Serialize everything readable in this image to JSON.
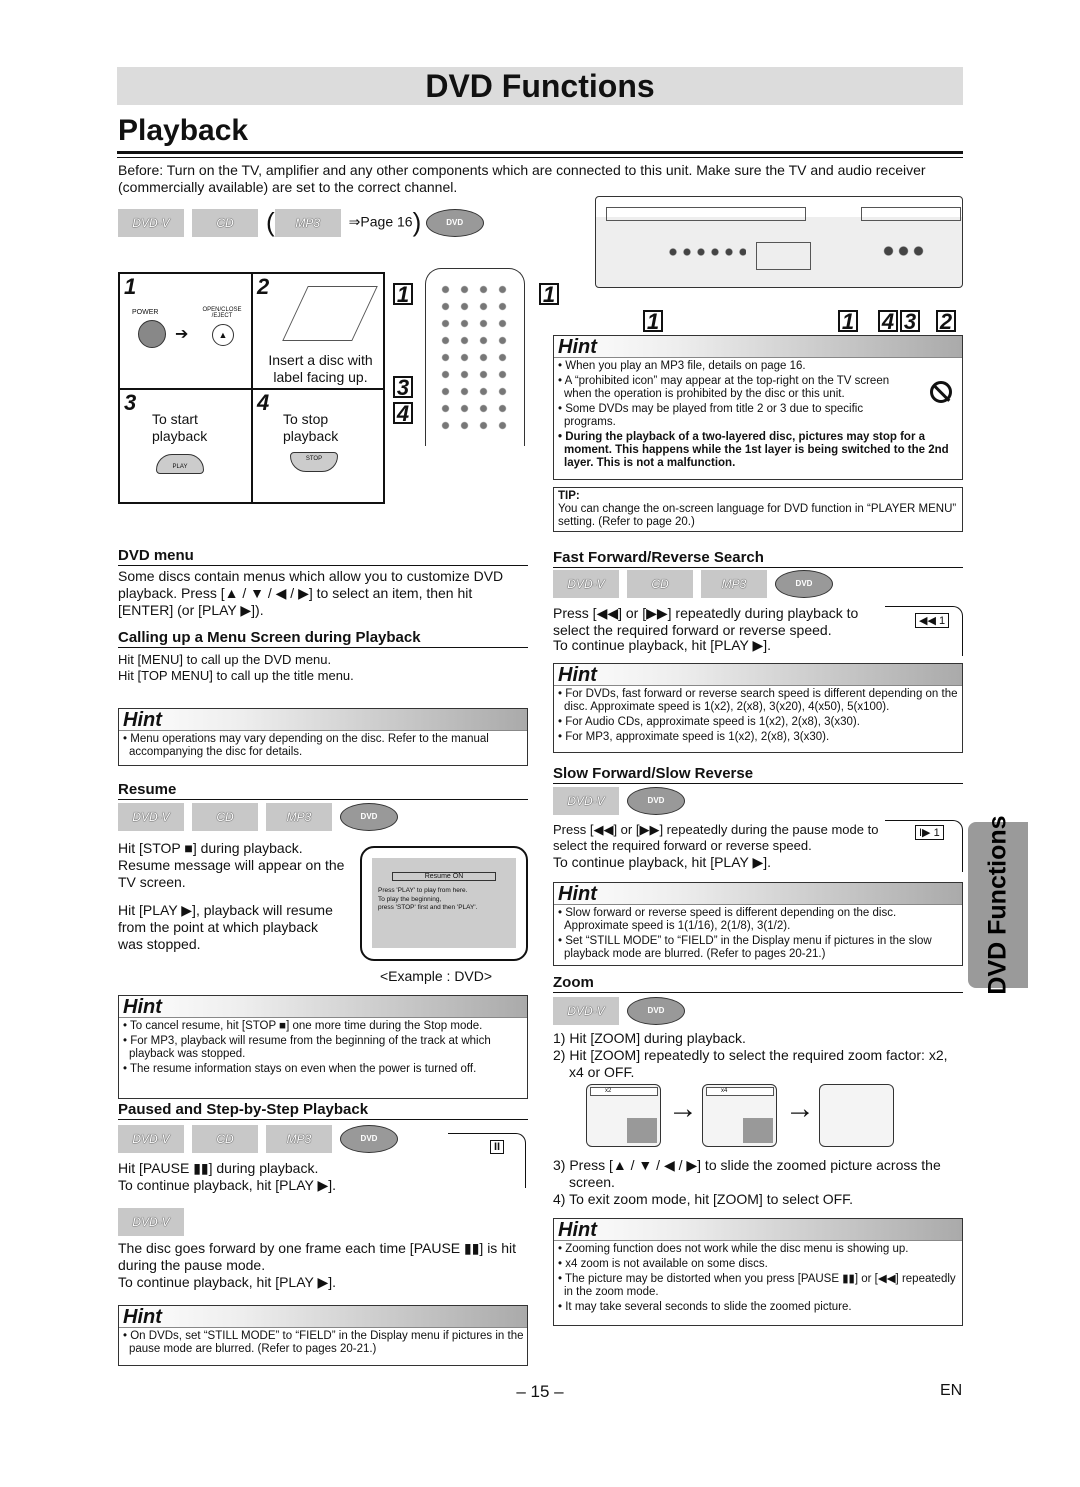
{
  "header": {
    "section": "DVD Functions",
    "title": "Playback"
  },
  "intro": "Before: Turn on the TV, amplifier and any other components which are connected to this unit. Make sure the TV and audio receiver (commercially available) are set to the correct channel.",
  "discs": {
    "dvdv": "DVD-V",
    "cd": "CD",
    "mp3": "MP3",
    "page_ref": "⇒Page 16",
    "dvd_logo": "DVD"
  },
  "steps": [
    {
      "num": "1",
      "power": "POWER",
      "eject": "OPEN/CLOSE /EJECT"
    },
    {
      "num": "2",
      "text": "Insert a disc with label facing up."
    },
    {
      "num": "3",
      "text": "To start playback",
      "button": "PLAY"
    },
    {
      "num": "4",
      "text": "To stop playback",
      "button": "STOP"
    }
  ],
  "remote_callouts": [
    "1",
    "1",
    "3",
    "4"
  ],
  "unit_callouts": [
    "1",
    "1",
    "4",
    "3",
    "2"
  ],
  "hint_label": "Hint",
  "hint_main": [
    "When you play an MP3 file, details on page 16.",
    "A “prohibited icon” may appear at the top-right on the TV screen when the operation is prohibited by the disc or this unit.",
    "Some DVDs may be played from title 2 or 3 due to specific programs.",
    "During the playback of a two-layered disc, pictures may stop for a moment. This happens while the 1st layer is being switched to the 2nd layer. This is not a malfunction."
  ],
  "tip": {
    "label": "TIP:",
    "text": "You can change the on-screen language for DVD function in “PLAYER MENU” setting. (Refer to page 20.)"
  },
  "dvd_menu": {
    "heading": "DVD menu",
    "text": "Some discs contain menus which allow you to customize DVD playback. Press [▲ / ▼ / ◀ / ▶] to select an item, then hit [ENTER] (or [PLAY ▶]).",
    "sub_heading": "Calling up a Menu Screen during Playback",
    "bullets": [
      "Hit [MENU] to call up the DVD menu.",
      "Hit [TOP MENU] to call up the title menu."
    ],
    "hint": [
      "Menu operations may vary depending on the disc. Refer to the manual accompanying the disc for details."
    ]
  },
  "resume": {
    "heading": "Resume",
    "text1": "Hit [STOP ■] during playback. Resume message will appear on the TV screen.",
    "text2": "Hit [PLAY ▶], playback will resume from the point at which playback was stopped.",
    "tv_title": "Resume ON",
    "tv_lines": [
      "Press 'PLAY' to play from here.",
      "To play the beginning,",
      "press 'STOP' first and then 'PLAY'."
    ],
    "caption": "<Example : DVD>",
    "hint": [
      "To cancel resume, hit [STOP ■] one more time during the Stop mode.",
      "For MP3, playback will resume from the beginning  of the track at which playback was stopped.",
      "The resume information stays on even when the power is turned off."
    ]
  },
  "pause": {
    "heading": "Paused and Step-by-Step Playback",
    "indicator": "II",
    "text1": "Hit [PAUSE ▮▮] during playback.",
    "text2": "To continue playback, hit [PLAY ▶].",
    "text3": "The disc goes forward by one frame each time [PAUSE ▮▮] is hit during the pause mode.",
    "text4": "To continue playback, hit [PLAY ▶].",
    "hint": [
      "On DVDs, set “STILL MODE” to “FIELD” in the Display menu if pictures in the pause mode are blurred. (Refer to pages 20-21.)"
    ]
  },
  "ffrev": {
    "heading": "Fast Forward/Reverse Search",
    "text": "Press [◀◀] or [▶▶] repeatedly during playback to select the required forward or reverse speed.",
    "text2": "To continue playback, hit [PLAY ▶].",
    "indicator": "◀◀ 1",
    "hint": [
      "For DVDs, fast forward or reverse search speed is different depending on the disc. Approximate speed is 1(x2), 2(x8), 3(x20), 4(x50), 5(x100).",
      "For Audio CDs, approximate speed is 1(x2), 2(x8), 3(x30).",
      "For MP3, approximate speed is 1(x2), 2(x8), 3(x30)."
    ]
  },
  "slow": {
    "heading": "Slow Forward/Slow Reverse",
    "text": "Press [◀◀] or [▶▶] repeatedly during the pause mode to select the required forward or reverse speed.",
    "text2": "To continue playback, hit [PLAY ▶].",
    "indicator": "I▶ 1",
    "hint": [
      "Slow forward or reverse speed is different depending on the disc. Approximate speed is 1(1/16), 2(1/8), 3(1/2).",
      "Set “STILL MODE”  to “FIELD” in the Display menu if pictures in the slow playback mode are blurred. (Refer to pages 20-21.)"
    ]
  },
  "zoom": {
    "heading": "Zoom",
    "steps": [
      "1) Hit [ZOOM] during playback.",
      "2) Hit [ZOOM] repeatedly to select the required zoom factor: x2, x4 or OFF.",
      "3) Press [▲ / ▼ / ◀ / ▶] to slide the zoomed picture across the screen.",
      "4) To exit zoom mode, hit [ZOOM] to select OFF."
    ],
    "factors": [
      "x2",
      "x4"
    ],
    "hint": [
      "Zooming function does not work while the disc menu is showing up.",
      "x4 zoom is not available on some discs.",
      "The picture may be distorted when you press [PAUSE ▮▮] or [◀◀] repeatedly in the zoom mode.",
      "It may take several seconds to slide the zoomed picture."
    ]
  },
  "side_tab": "DVD Functions",
  "footer": {
    "page": "– 15 –",
    "lang": "EN"
  }
}
